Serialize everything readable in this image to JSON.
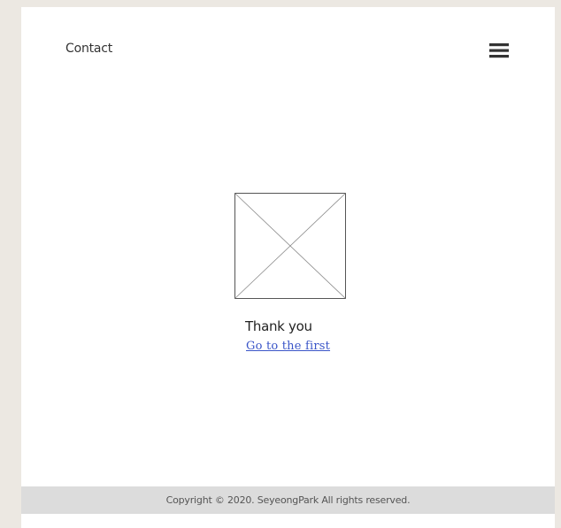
{
  "header": {
    "title": "Contact",
    "menu_icon": "hamburger-menu-icon"
  },
  "main": {
    "image_icon": "image-placeholder-icon",
    "message": "Thank you",
    "link_label": "Go to the first"
  },
  "footer": {
    "copyright": "Copyright © 2020. SeyeongPark All rights reserved."
  },
  "colors": {
    "background": "#ece8e2",
    "page": "#ffffff",
    "footer": "#dcdcdc",
    "link": "#3a55c8"
  }
}
